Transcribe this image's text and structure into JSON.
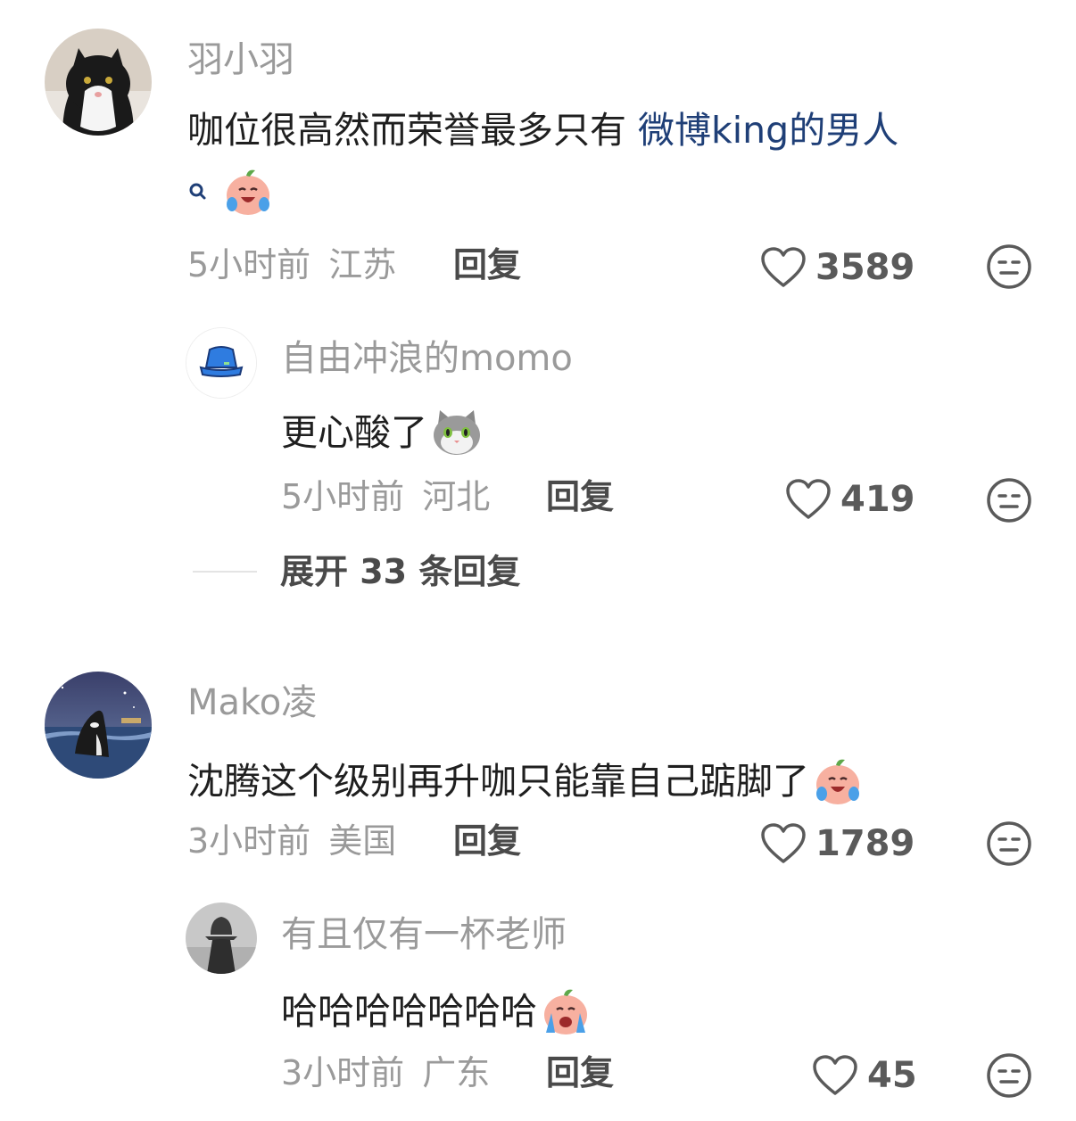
{
  "comments": [
    {
      "username": "羽小羽",
      "text": "咖位很高然而荣誉最多只有 ",
      "link_text": "微博king的男人",
      "time": "5小时前",
      "location": "江苏",
      "reply_label": "回复",
      "likes": "3589",
      "avatar": "cat-avatar",
      "replies": [
        {
          "username": "自由冲浪的momo",
          "text": "更心酸了",
          "time": "5小时前",
          "location": "河北",
          "reply_label": "回复",
          "likes": "419",
          "avatar": "bucket-hat-avatar"
        }
      ],
      "expand_label": "展开 33 条回复"
    },
    {
      "username": "Mako凌",
      "text": "沈腾这个级别再升咖只能靠自己踮脚了",
      "time": "3小时前",
      "location": "美国",
      "reply_label": "回复",
      "likes": "1789",
      "avatar": "orca-avatar",
      "replies": [
        {
          "username": "有且仅有一杯老师",
          "text": "哈哈哈哈哈哈哈",
          "time": "3小时前",
          "location": "广东",
          "reply_label": "回复",
          "likes": "45",
          "avatar": "silhouette-avatar"
        }
      ]
    }
  ],
  "colors": {
    "link": "#1f3f77",
    "meta": "#9a9a9a",
    "text": "#1f1f1f"
  }
}
